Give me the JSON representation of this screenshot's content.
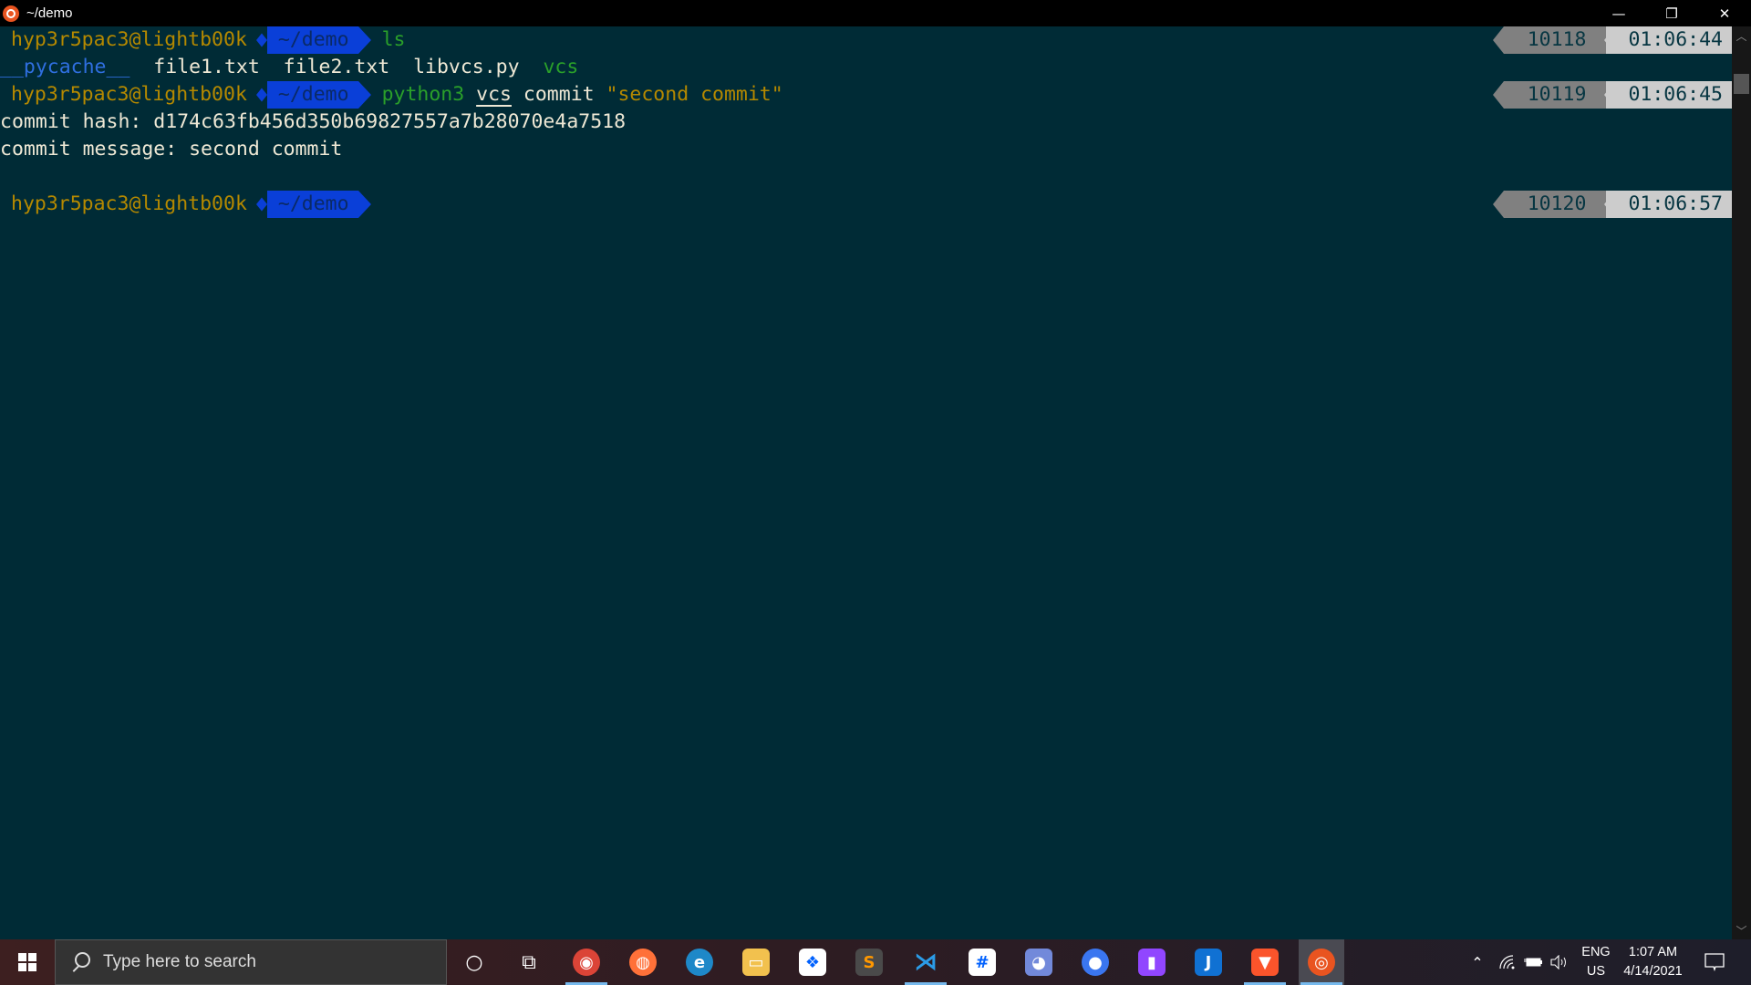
{
  "window": {
    "title": "~/demo",
    "controls": {
      "minimize": "—",
      "restore": "❐",
      "close": "✕"
    }
  },
  "terminal": {
    "prompt": {
      "user_host": "hyp3r5pac3@lightb00k",
      "dir": "~/demo"
    },
    "lines": [
      {
        "type": "prompt",
        "command": [
          {
            "text": "ls",
            "style": "green"
          }
        ],
        "history": "10118",
        "time": "01:06:44"
      },
      {
        "type": "output",
        "segments": [
          {
            "text": "__pycache__",
            "style": "blue"
          },
          {
            "text": "  ",
            "style": "white"
          },
          {
            "text": "file1.txt",
            "style": "white"
          },
          {
            "text": "  ",
            "style": "white"
          },
          {
            "text": "file2.txt",
            "style": "white"
          },
          {
            "text": "  ",
            "style": "white"
          },
          {
            "text": "libvcs.py",
            "style": "white"
          },
          {
            "text": "  ",
            "style": "white"
          },
          {
            "text": "vcs",
            "style": "green"
          }
        ]
      },
      {
        "type": "prompt",
        "command": [
          {
            "text": "python3",
            "style": "green"
          },
          {
            "text": " ",
            "style": "white"
          },
          {
            "text": "vcs",
            "style": "white-underline"
          },
          {
            "text": " commit ",
            "style": "white"
          },
          {
            "text": "\"second commit\"",
            "style": "yellow"
          }
        ],
        "history": "10119",
        "time": "01:06:45"
      },
      {
        "type": "output",
        "segments": [
          {
            "text": "commit hash: d174c63fb456d350b69827557a7b28070e4a7518",
            "style": "white"
          }
        ]
      },
      {
        "type": "output",
        "segments": [
          {
            "text": "commit message: second commit",
            "style": "white"
          }
        ]
      },
      {
        "type": "blank"
      },
      {
        "type": "prompt",
        "command": [],
        "history": "10120",
        "time": "01:06:57"
      }
    ]
  },
  "taskbar": {
    "search_placeholder": "Type here to search",
    "apps": [
      {
        "name": "cortana",
        "icon": "cortana-icon",
        "glyph": "○",
        "bg": "transparent",
        "running": false
      },
      {
        "name": "task-view",
        "icon": "task-view-icon",
        "glyph": "⧉",
        "bg": "transparent",
        "running": false
      },
      {
        "name": "chrome",
        "icon": "chrome-icon",
        "glyph": "◉",
        "bg": "#db4437",
        "running": true
      },
      {
        "name": "firefox",
        "icon": "firefox-icon",
        "glyph": "◍",
        "bg": "#ff7139",
        "running": false
      },
      {
        "name": "edge",
        "icon": "edge-icon",
        "glyph": "e",
        "bg": "#1e88c8",
        "running": false
      },
      {
        "name": "file-explorer",
        "icon": "folder-icon",
        "glyph": "▭",
        "bg": "#f2c14e",
        "running": false
      },
      {
        "name": "dropbox",
        "icon": "dropbox-icon",
        "glyph": "❖",
        "bg": "#ffffff",
        "running": false
      },
      {
        "name": "sublime-text",
        "icon": "sublime-icon",
        "glyph": "S",
        "bg": "#4a4a4a",
        "running": false
      },
      {
        "name": "vscode",
        "icon": "vscode-icon",
        "glyph": "⋊",
        "bg": "transparent",
        "running": true
      },
      {
        "name": "slack",
        "icon": "slack-icon",
        "glyph": "#",
        "bg": "#ffffff",
        "running": false
      },
      {
        "name": "discord",
        "icon": "discord-icon",
        "glyph": "◕",
        "bg": "#7289da",
        "running": false
      },
      {
        "name": "signal",
        "icon": "signal-icon",
        "glyph": "●",
        "bg": "#3a76f0",
        "running": false
      },
      {
        "name": "twitch",
        "icon": "twitch-icon",
        "glyph": "▮",
        "bg": "#9146ff",
        "running": false
      },
      {
        "name": "joplin",
        "icon": "joplin-icon",
        "glyph": "J",
        "bg": "#1071d3",
        "running": false
      },
      {
        "name": "brave",
        "icon": "brave-icon",
        "glyph": "▼",
        "bg": "#fb542b",
        "running": true
      },
      {
        "name": "ubuntu",
        "icon": "ubuntu-icon",
        "glyph": "◎",
        "bg": "#e95420",
        "running": true,
        "active": true
      }
    ],
    "tray": {
      "chevron": "^",
      "language_top": "ENG",
      "language_bottom": "US",
      "time": "1:07 AM",
      "date": "4/14/2021"
    }
  },
  "colors": {
    "terminal_bg": "#002b36",
    "user": "#b58900",
    "dir_bg": "#0a3fd8",
    "green": "#2aa02a",
    "yellow": "#b58900",
    "blue": "#2f6fe0",
    "history_bg": "#808080",
    "time_bg": "#cccccc"
  }
}
